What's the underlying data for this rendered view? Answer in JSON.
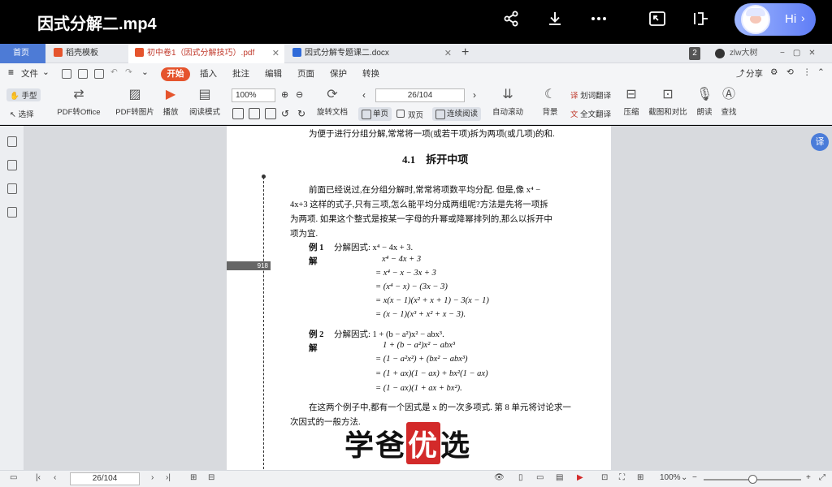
{
  "player": {
    "title": "因式分解二.mp4",
    "icons": [
      "share-icon",
      "download-icon",
      "more-icon",
      "picture-in-picture-icon",
      "pin-icon"
    ],
    "ai_label": "Hi"
  },
  "tabs": {
    "home": "首页",
    "items": [
      {
        "label": "稻壳模板"
      },
      {
        "label": "初中卷1（因式分解技巧）.pdf"
      },
      {
        "label": "因式分解专题课二.docx"
      }
    ],
    "window_count": "2",
    "user": "zlw大树"
  },
  "menu": {
    "file": "文件",
    "start": "开始",
    "items": [
      "插入",
      "批注",
      "编辑",
      "页面",
      "保护",
      "转换"
    ],
    "share": "分享"
  },
  "toolbar": {
    "hand": "手型",
    "select": "选择",
    "pdf_to_office": "PDF转Office",
    "pdf_to_image": "PDF转图片",
    "play": "播放",
    "read_mode": "阅读模式",
    "zoom": "100%",
    "rotate": "旋转文档",
    "single": "单页",
    "double": "双页",
    "continuous": "连续阅读",
    "page_display": "26/104",
    "auto_scroll": "自动滚动",
    "background": "背景",
    "translate_word": "划词翻译",
    "translate_full": "全文翻译",
    "compress": "压缩",
    "screenshot_compare": "截图和对比",
    "read_aloud": "朗读",
    "find": "查找"
  },
  "document": {
    "intro": "为便于进行分组分解,常常将一项(或若干项)拆为两项(或几项)的和.",
    "heading": "4.1　拆开中项",
    "para1_l1": "前面已经说过,在分组分解时,常常将项数平均分配. 但是,像 x⁴ −",
    "para1_l2": "4x+3 这样的式子,只有三项,怎么能平均分成两组呢?方法是先将一项拆",
    "para1_l3": "为两项. 如果这个整式是按某一字母的升幂或降幂排列的,那么以拆开中",
    "para1_l4": "项为宜.",
    "ex1_label": "例 1",
    "ex1_text": "分解因式: x⁴ − 4x + 3.",
    "sol_label": "解",
    "ex1_steps": [
      "x⁴ − 4x + 3",
      "= x⁴ − x − 3x + 3",
      "= (x⁴ − x) − (3x − 3)",
      "= x(x − 1)(x² + x + 1) − 3(x − 1)",
      "= (x − 1)(x³ + x² + x − 3)."
    ],
    "ex2_label": "例 2",
    "ex2_text": "分解因式: 1 + (b − a²)x² − abx³.",
    "ex2_steps": [
      "1 + (b − a²)x² − abx³",
      "= (1 − a²x²) + (bx² − abx³)",
      "= (1 + ax)(1 − ax) + bx²(1 − ax)",
      "= (1 − ax)(1 + ax + bx²)."
    ],
    "para2_l1": "在这两个例子中,都有一个因式是 x 的一次多项式. 第 8 单元将讨论求一",
    "para2_l2": "次因式的一般方法.",
    "margin_tab": "918"
  },
  "watermark": {
    "part1": "学爸",
    "part2": "优",
    "part3": "选"
  },
  "statusbar": {
    "page": "26/104",
    "zoom": "100%",
    "zoom_level_fraction": 0.5
  },
  "colors": {
    "start_button": "#e5542d",
    "home_tab": "#4d7bd6",
    "watermark_red": "#d32a2a"
  }
}
